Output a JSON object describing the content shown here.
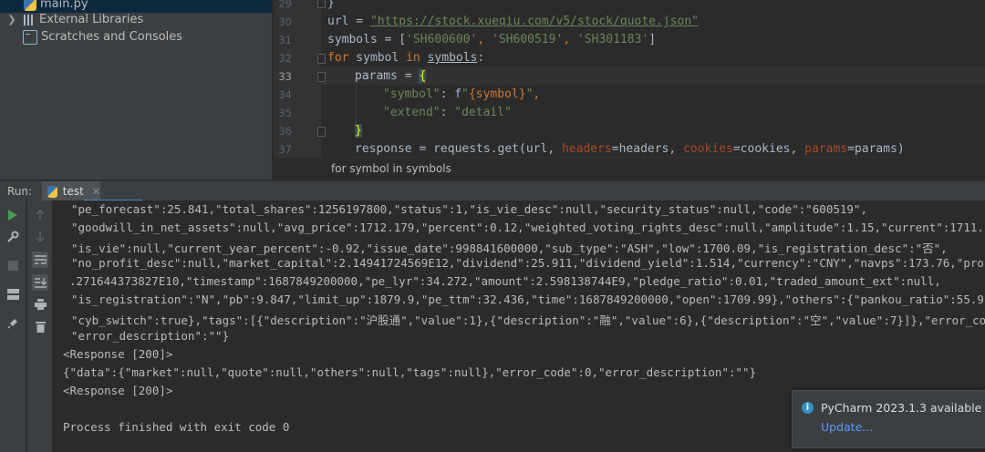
{
  "project": {
    "items": [
      {
        "label": "main.py",
        "icon": "python-file-icon"
      },
      {
        "label": "External Libraries",
        "icon": "library-icon"
      },
      {
        "label": "Scratches and Consoles",
        "icon": "scratches-icon"
      }
    ]
  },
  "editor": {
    "line_numbers": [
      "29",
      "30",
      "31",
      "32",
      "33",
      "34",
      "35",
      "36",
      "37"
    ],
    "current_line": "33",
    "code": {
      "l29": "}",
      "l30_var": "url = ",
      "l30_str": "\"https://stock.xueqiu.com/v5/stock/quote.json\"",
      "l31_var": "symbols = [",
      "l31_s1": "'SH600600'",
      "l31_sep1": ", ",
      "l31_s2": "'SH600519'",
      "l31_sep2": ", ",
      "l31_s3": "'SH301183'",
      "l31_end": "]",
      "l32_for": "for",
      "l32_mid": " symbol ",
      "l32_in": "in",
      "l32_sp": " ",
      "l32_link": "symbols",
      "l32_end": ":",
      "l33_var": "params = ",
      "l33_brace": "{",
      "l34_key": "\"symbol\"",
      "l34_mid": ": f",
      "l34_s1": "\"",
      "l34_expr": "{symbol}",
      "l34_s2": "\"",
      "l34_end": ",",
      "l35_key": "\"extend\"",
      "l35_mid": ": ",
      "l35_val": "\"detail\"",
      "l36_brace": "}",
      "l37_a": "response = requests.get(url, ",
      "l37_p1": "headers",
      "l37_b": "=headers, ",
      "l37_p2": "cookies",
      "l37_c": "=cookies, ",
      "l37_p3": "params",
      "l37_d": "=params)"
    },
    "breadcrumb": "for symbol in symbols"
  },
  "run": {
    "label": "Run:",
    "tab_name": "test",
    "console_lines": [
      "\"pe_forecast\":25.841,\"total_shares\":1256197800,\"status\":1,\"is_vie_desc\":null,\"security_status\":null,\"code\":\"600519\",",
      "\"goodwill_in_net_assets\":null,\"avg_price\":1712.179,\"percent\":0.12,\"weighted_voting_rights_desc\":null,\"amplitude\":1.15,\"current\":1711.",
      "\"is_vie\":null,\"current_year_percent\":-0.92,\"issue_date\":998841600000,\"sub_type\":\"ASH\",\"low\":1700.09,\"is_registration_desc\":\"否\",",
      "\"no_profit_desc\":null,\"market_capital\":2.14941724569E12,\"dividend\":25.911,\"dividend_yield\":1.514,\"currency\":\"CNY\",\"navps\":173.76,\"pro",
      ".271644373827E10,\"timestamp\":1687849200000,\"pe_lyr\":34.272,\"amount\":2.598138744E9,\"pledge_ratio\":0.01,\"traded_amount_ext\":null,",
      "\"is_registration\":\"N\",\"pb\":9.847,\"limit_up\":1879.9,\"pe_ttm\":32.436,\"time\":1687849200000,\"open\":1709.99},\"others\":{\"pankou_ratio\":55.9",
      "\"cyb_switch\":true},\"tags\":[{\"description\":\"沪股通\",\"value\":1},{\"description\":\"融\",\"value\":6},{\"description\":\"空\",\"value\":7}]},\"error_co",
      "\"error_description\":\"\"}",
      "<Response [200]>",
      "{\"data\":{\"market\":null,\"quote\":null,\"others\":null,\"tags\":null},\"error_code\":0,\"error_description\":\"\"}",
      "<Response [200]>",
      "",
      "Process finished with exit code 0"
    ]
  },
  "notification": {
    "title": "PyCharm 2023.1.3 available",
    "link": "Update..."
  }
}
